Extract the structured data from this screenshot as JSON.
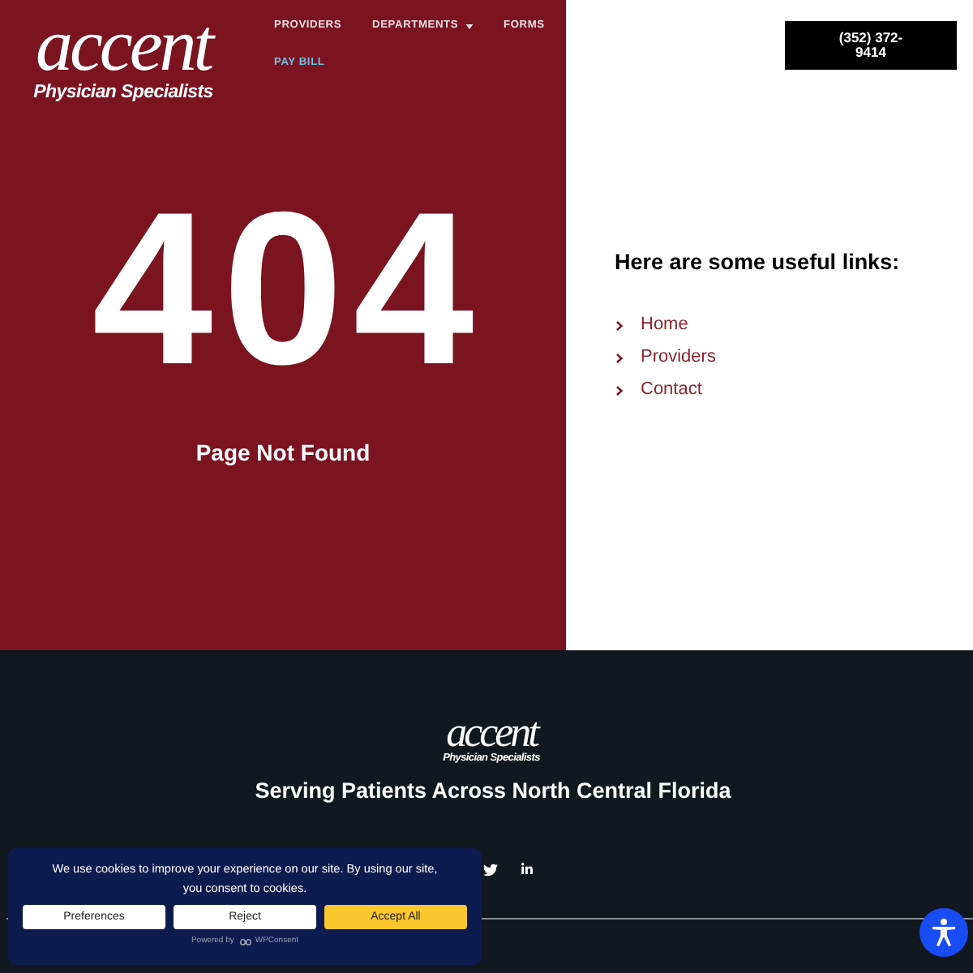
{
  "header": {
    "logo": {
      "wordmark": "accent",
      "tagline": "Physician Specialists"
    },
    "nav": [
      {
        "label": "PROVIDERS",
        "selected": false,
        "dropdown": false
      },
      {
        "label": "DEPARTMENTS",
        "selected": false,
        "dropdown": true
      },
      {
        "label": "FORMS",
        "selected": false,
        "dropdown": false
      },
      {
        "label": "PAY BILL",
        "selected": true,
        "dropdown": false
      }
    ],
    "phone_button": "(352) 372-9414"
  },
  "error": {
    "code": "404",
    "message": "Page Not Found"
  },
  "links": {
    "heading": "Here are some useful links:",
    "items": [
      "Home",
      "Providers",
      "Contact"
    ]
  },
  "footer": {
    "logo": {
      "wordmark": "accent",
      "tagline": "Physician Specialists"
    },
    "tagline": "Serving Patients Across North Central Florida",
    "social": [
      {
        "kind": "twitter"
      },
      {
        "kind": "linkedin"
      }
    ]
  },
  "cookie_banner": {
    "message": "We use cookies to improve your experience on our site. By using our site, you consent to cookies.",
    "buttons": [
      {
        "label": "Preferences",
        "kind": "secondary"
      },
      {
        "label": "Reject",
        "kind": "secondary"
      },
      {
        "label": "Accept All",
        "kind": "primary"
      }
    ],
    "powered_by": "Powered by",
    "brand": "WPConsent"
  }
}
